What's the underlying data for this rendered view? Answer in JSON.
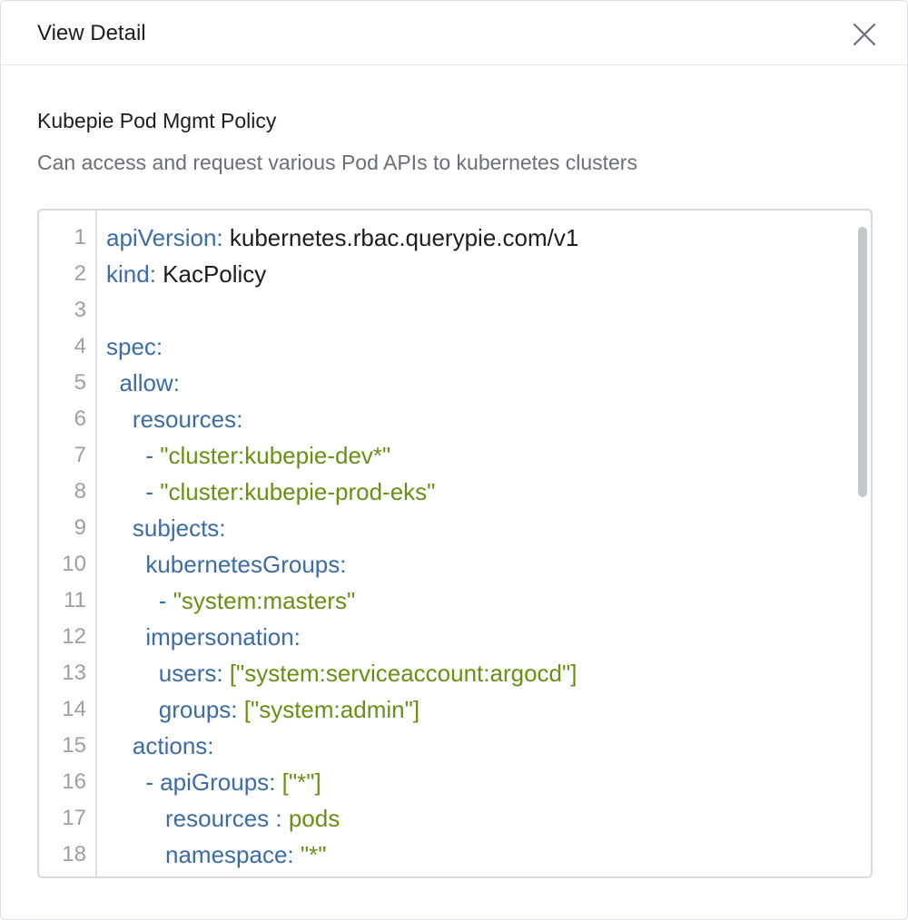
{
  "dialog": {
    "title": "View Detail",
    "close_icon": "close-icon"
  },
  "policy": {
    "name": "Kubepie Pod Mgmt Policy",
    "description": "Can access and request various Pod APIs to kubernetes clusters"
  },
  "editor": {
    "lines": [
      {
        "no": "1",
        "indent": "",
        "parts": [
          {
            "t": "apiVersion:",
            "c": "k"
          },
          {
            "t": " kubernetes.rbac.querypie.com/v1",
            "c": "p"
          }
        ]
      },
      {
        "no": "2",
        "indent": "",
        "parts": [
          {
            "t": "kind:",
            "c": "k"
          },
          {
            "t": " KacPolicy",
            "c": "p"
          }
        ]
      },
      {
        "no": "3",
        "indent": "",
        "parts": []
      },
      {
        "no": "4",
        "indent": "",
        "parts": [
          {
            "t": "spec:",
            "c": "k"
          }
        ]
      },
      {
        "no": "5",
        "indent": "  ",
        "parts": [
          {
            "t": "allow:",
            "c": "k"
          }
        ]
      },
      {
        "no": "6",
        "indent": "    ",
        "parts": [
          {
            "t": "resources:",
            "c": "k"
          }
        ]
      },
      {
        "no": "7",
        "indent": "      ",
        "parts": [
          {
            "t": "- ",
            "c": "k"
          },
          {
            "t": "\"cluster:kubepie-dev*\"",
            "c": "s"
          }
        ]
      },
      {
        "no": "8",
        "indent": "      ",
        "parts": [
          {
            "t": "- ",
            "c": "k"
          },
          {
            "t": "\"cluster:kubepie-prod-eks\"",
            "c": "s"
          }
        ]
      },
      {
        "no": "9",
        "indent": "    ",
        "parts": [
          {
            "t": "subjects:",
            "c": "k"
          }
        ]
      },
      {
        "no": "10",
        "indent": "      ",
        "parts": [
          {
            "t": "kubernetesGroups:",
            "c": "k"
          }
        ]
      },
      {
        "no": "11",
        "indent": "        ",
        "parts": [
          {
            "t": "- ",
            "c": "k"
          },
          {
            "t": "\"system:masters\"",
            "c": "s"
          }
        ]
      },
      {
        "no": "12",
        "indent": "      ",
        "parts": [
          {
            "t": "impersonation:",
            "c": "k"
          }
        ]
      },
      {
        "no": "13",
        "indent": "        ",
        "parts": [
          {
            "t": "users:",
            "c": "k"
          },
          {
            "t": " [\"system:serviceaccount:argocd\"]",
            "c": "s"
          }
        ]
      },
      {
        "no": "14",
        "indent": "        ",
        "parts": [
          {
            "t": "groups:",
            "c": "k"
          },
          {
            "t": " [\"system:admin\"]",
            "c": "s"
          }
        ]
      },
      {
        "no": "15",
        "indent": "    ",
        "parts": [
          {
            "t": "actions:",
            "c": "k"
          }
        ]
      },
      {
        "no": "16",
        "indent": "      ",
        "parts": [
          {
            "t": "- apiGroups:",
            "c": "k"
          },
          {
            "t": " [\"*\"]",
            "c": "s"
          }
        ]
      },
      {
        "no": "17",
        "indent": "         ",
        "parts": [
          {
            "t": "resources :",
            "c": "k"
          },
          {
            "t": " pods",
            "c": "s"
          }
        ]
      },
      {
        "no": "18",
        "indent": "         ",
        "parts": [
          {
            "t": "namespace:",
            "c": "k"
          },
          {
            "t": " \"*\"",
            "c": "s"
          }
        ]
      }
    ]
  },
  "colors": {
    "key": "#3a6ca8",
    "string": "#6c8e12",
    "text": "#1b1d21",
    "muted": "#6b6f76"
  }
}
